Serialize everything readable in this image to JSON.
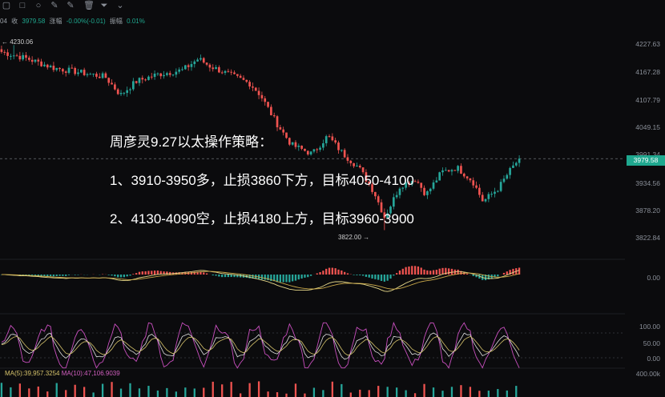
{
  "toolbar": {
    "icons": [
      "square-icon",
      "square-outline-icon",
      "circle-icon",
      "edit-icon",
      "trash-icon",
      "funnel-icon",
      "chevron-down-icon"
    ]
  },
  "quote": {
    "prefix": "04",
    "close_label": "收",
    "close_value": "3979.58",
    "change_label": "涨幅",
    "change_value": "-0.00%(-0.01)",
    "amplitude_label": "振幅",
    "amplitude_value": "0.01%"
  },
  "colors": {
    "up": "#26a69a",
    "down": "#ef5350",
    "background": "#0b0b0d",
    "ma5": "#d6c36b",
    "ma10": "#d15fbf",
    "last_price": "#1fa88f"
  },
  "annotations": {
    "high": "← 4230.06",
    "low": "3822.00 →"
  },
  "strategy": {
    "title": "周彦灵9.27以太操作策略：",
    "line1": "1、3910-3950多，止损3860下方，目标4050-4100",
    "line2": "2、4130-4090空，止损4180上方，目标3960-3900"
  },
  "last_price": "3979.58",
  "ma_legend": {
    "ma5": "MA(5):39,957.3254",
    "ma10": "MA(10):47,106.9039"
  },
  "chart_data": {
    "type": "candlestick",
    "price_axis_ticks": [
      "4227.63",
      "4167.28",
      "4107.79",
      "4049.15",
      "3991.34",
      "3934.56",
      "3878.20",
      "3822.84"
    ],
    "price_ylim": [
      3800,
      4250
    ],
    "high": 4230.06,
    "low": 3822.0,
    "last": 3979.58,
    "macd_ticks": [
      "0.00"
    ],
    "oscillator_ticks": [
      "100.00",
      "50.00",
      "0.00"
    ],
    "volume_ticks": [
      "400.00k"
    ],
    "close_anchors": [
      [
        0,
        4215
      ],
      [
        0.05,
        4200
      ],
      [
        0.1,
        4180
      ],
      [
        0.15,
        4170
      ],
      [
        0.2,
        4160
      ],
      [
        0.23,
        4120
      ],
      [
        0.26,
        4150
      ],
      [
        0.3,
        4165
      ],
      [
        0.35,
        4175
      ],
      [
        0.38,
        4200
      ],
      [
        0.4,
        4185
      ],
      [
        0.45,
        4160
      ],
      [
        0.48,
        4145
      ],
      [
        0.5,
        4120
      ],
      [
        0.53,
        4060
      ],
      [
        0.56,
        4010
      ],
      [
        0.6,
        3990
      ],
      [
        0.63,
        4030
      ],
      [
        0.66,
        3990
      ],
      [
        0.69,
        3960
      ],
      [
        0.72,
        3905
      ],
      [
        0.74,
        3850
      ],
      [
        0.77,
        3920
      ],
      [
        0.8,
        3935
      ],
      [
        0.82,
        3900
      ],
      [
        0.85,
        3950
      ],
      [
        0.88,
        3960
      ],
      [
        0.91,
        3930
      ],
      [
        0.93,
        3885
      ],
      [
        0.96,
        3915
      ],
      [
        0.98,
        3950
      ],
      [
        1,
        3979.58
      ]
    ]
  }
}
